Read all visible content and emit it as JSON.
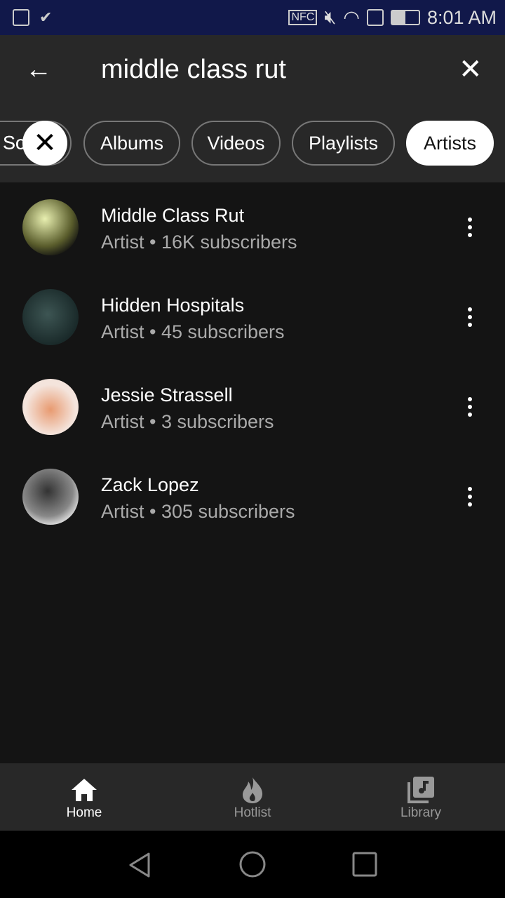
{
  "status_bar": {
    "time": "8:01 AM",
    "nfc": "NFC"
  },
  "search": {
    "query": "middle class rut"
  },
  "chips": [
    {
      "label": "Songs",
      "visible": "So"
    },
    {
      "label": "Albums"
    },
    {
      "label": "Videos"
    },
    {
      "label": "Playlists"
    },
    {
      "label": "Artists",
      "active": true
    }
  ],
  "results": [
    {
      "name": "Middle Class Rut",
      "subtitle": "Artist • 16K subscribers",
      "avatar_color": "#6b6f3a"
    },
    {
      "name": "Hidden Hospitals",
      "subtitle": "Artist • 45 subscribers",
      "avatar_color": "#1f3433"
    },
    {
      "name": "Jessie Strassell",
      "subtitle": "Artist • 3 subscribers",
      "avatar_color": "#e9c3b3"
    },
    {
      "name": "Zack Lopez",
      "subtitle": "Artist • 305 subscribers",
      "avatar_color": "#6a6a6a"
    }
  ],
  "bottom_nav": [
    {
      "label": "Home",
      "icon": "home-icon",
      "active": true
    },
    {
      "label": "Hotlist",
      "icon": "fire-icon"
    },
    {
      "label": "Library",
      "icon": "library-music-icon"
    }
  ],
  "colors": {
    "status_bar": "#11184a",
    "header": "#282828",
    "background": "#141414"
  }
}
